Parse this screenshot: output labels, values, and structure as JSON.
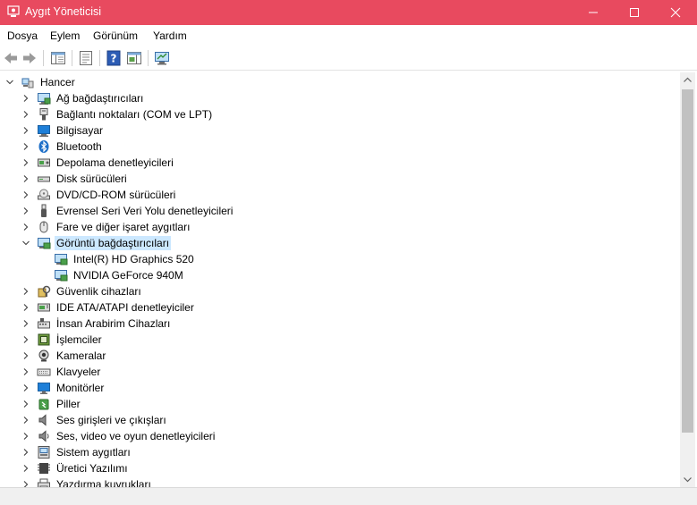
{
  "window": {
    "title": "Aygıt Yöneticisi",
    "titlebar_color": "#e84a5f"
  },
  "menubar": {
    "items": [
      "Dosya",
      "Eylem",
      "Görünüm",
      "Yardım"
    ]
  },
  "toolbar": {
    "icons": [
      "back-arrow-icon",
      "forward-arrow-icon",
      "show-hide-console-tree-icon",
      "properties-icon",
      "help-icon",
      "action-pane-icon",
      "monitor-scan-icon"
    ]
  },
  "tree": {
    "root": {
      "label": "Hancer",
      "expanded": true,
      "icon": "computer-root-icon"
    },
    "categories": [
      {
        "label": "Ağ bağdaştırıcıları",
        "icon": "network-adapter-icon"
      },
      {
        "label": "Bağlantı noktaları (COM ve LPT)",
        "icon": "port-icon"
      },
      {
        "label": "Bilgisayar",
        "icon": "computer-icon"
      },
      {
        "label": "Bluetooth",
        "icon": "bluetooth-icon"
      },
      {
        "label": "Depolama denetleyicileri",
        "icon": "storage-controller-icon"
      },
      {
        "label": "Disk sürücüleri",
        "icon": "disk-drive-icon"
      },
      {
        "label": "DVD/CD-ROM sürücüleri",
        "icon": "dvd-drive-icon"
      },
      {
        "label": "Evrensel Seri Veri Yolu denetleyicileri",
        "icon": "usb-icon"
      },
      {
        "label": "Fare ve diğer işaret aygıtları",
        "icon": "mouse-icon"
      },
      {
        "label": "Görüntü bağdaştırıcıları",
        "icon": "display-adapter-icon",
        "expanded": true,
        "selected": true,
        "children": [
          {
            "label": "Intel(R) HD Graphics 520",
            "icon": "display-adapter-icon"
          },
          {
            "label": "NVIDIA GeForce 940M",
            "icon": "display-adapter-icon"
          }
        ]
      },
      {
        "label": "Güvenlik cihazları",
        "icon": "security-device-icon"
      },
      {
        "label": "IDE ATA/ATAPI denetleyiciler",
        "icon": "ide-controller-icon"
      },
      {
        "label": "İnsan Arabirim Cihazları",
        "icon": "hid-icon"
      },
      {
        "label": "İşlemciler",
        "icon": "processor-icon"
      },
      {
        "label": "Kameralar",
        "icon": "camera-icon"
      },
      {
        "label": "Klavyeler",
        "icon": "keyboard-icon"
      },
      {
        "label": "Monitörler",
        "icon": "monitor-icon"
      },
      {
        "label": "Piller",
        "icon": "battery-icon"
      },
      {
        "label": "Ses girişleri ve çıkışları",
        "icon": "audio-io-icon"
      },
      {
        "label": "Ses, video ve oyun denetleyicileri",
        "icon": "sound-controller-icon"
      },
      {
        "label": "Sistem aygıtları",
        "icon": "system-device-icon"
      },
      {
        "label": "Üretici Yazılımı",
        "icon": "firmware-icon"
      },
      {
        "label": "Yazdırma kuyrukları",
        "icon": "print-queue-icon"
      }
    ]
  },
  "colors": {
    "selection": "#cce8ff",
    "accent_blue": "#1e6fc8"
  }
}
